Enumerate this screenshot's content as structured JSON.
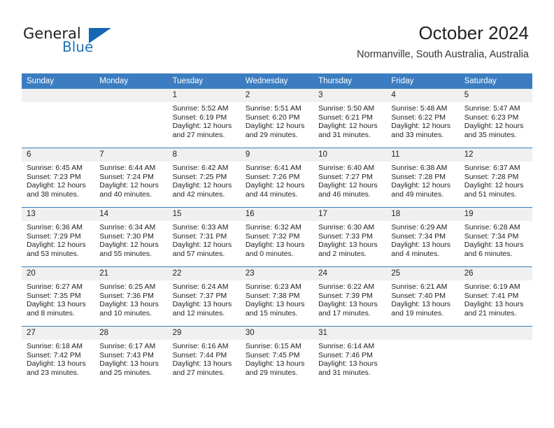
{
  "brand": {
    "word_one": "General",
    "word_two": "Blue",
    "logo_icon": "triangle-logo-icon",
    "accent_color": "#1667b1"
  },
  "header": {
    "title": "October 2024",
    "subtitle": "Normanville, South Australia, Australia"
  },
  "calendar": {
    "header_bg": "#3b7dc0",
    "daynum_bg": "#f0f0f0",
    "weekdays": [
      "Sunday",
      "Monday",
      "Tuesday",
      "Wednesday",
      "Thursday",
      "Friday",
      "Saturday"
    ],
    "weeks": [
      [
        {
          "day": ""
        },
        {
          "day": ""
        },
        {
          "day": "1",
          "sunrise": "Sunrise: 5:52 AM",
          "sunset": "Sunset: 6:19 PM",
          "daylight_1": "Daylight: 12 hours",
          "daylight_2": "and 27 minutes."
        },
        {
          "day": "2",
          "sunrise": "Sunrise: 5:51 AM",
          "sunset": "Sunset: 6:20 PM",
          "daylight_1": "Daylight: 12 hours",
          "daylight_2": "and 29 minutes."
        },
        {
          "day": "3",
          "sunrise": "Sunrise: 5:50 AM",
          "sunset": "Sunset: 6:21 PM",
          "daylight_1": "Daylight: 12 hours",
          "daylight_2": "and 31 minutes."
        },
        {
          "day": "4",
          "sunrise": "Sunrise: 5:48 AM",
          "sunset": "Sunset: 6:22 PM",
          "daylight_1": "Daylight: 12 hours",
          "daylight_2": "and 33 minutes."
        },
        {
          "day": "5",
          "sunrise": "Sunrise: 5:47 AM",
          "sunset": "Sunset: 6:23 PM",
          "daylight_1": "Daylight: 12 hours",
          "daylight_2": "and 35 minutes."
        }
      ],
      [
        {
          "day": "6",
          "sunrise": "Sunrise: 6:45 AM",
          "sunset": "Sunset: 7:23 PM",
          "daylight_1": "Daylight: 12 hours",
          "daylight_2": "and 38 minutes."
        },
        {
          "day": "7",
          "sunrise": "Sunrise: 6:44 AM",
          "sunset": "Sunset: 7:24 PM",
          "daylight_1": "Daylight: 12 hours",
          "daylight_2": "and 40 minutes."
        },
        {
          "day": "8",
          "sunrise": "Sunrise: 6:42 AM",
          "sunset": "Sunset: 7:25 PM",
          "daylight_1": "Daylight: 12 hours",
          "daylight_2": "and 42 minutes."
        },
        {
          "day": "9",
          "sunrise": "Sunrise: 6:41 AM",
          "sunset": "Sunset: 7:26 PM",
          "daylight_1": "Daylight: 12 hours",
          "daylight_2": "and 44 minutes."
        },
        {
          "day": "10",
          "sunrise": "Sunrise: 6:40 AM",
          "sunset": "Sunset: 7:27 PM",
          "daylight_1": "Daylight: 12 hours",
          "daylight_2": "and 46 minutes."
        },
        {
          "day": "11",
          "sunrise": "Sunrise: 6:38 AM",
          "sunset": "Sunset: 7:28 PM",
          "daylight_1": "Daylight: 12 hours",
          "daylight_2": "and 49 minutes."
        },
        {
          "day": "12",
          "sunrise": "Sunrise: 6:37 AM",
          "sunset": "Sunset: 7:28 PM",
          "daylight_1": "Daylight: 12 hours",
          "daylight_2": "and 51 minutes."
        }
      ],
      [
        {
          "day": "13",
          "sunrise": "Sunrise: 6:36 AM",
          "sunset": "Sunset: 7:29 PM",
          "daylight_1": "Daylight: 12 hours",
          "daylight_2": "and 53 minutes."
        },
        {
          "day": "14",
          "sunrise": "Sunrise: 6:34 AM",
          "sunset": "Sunset: 7:30 PM",
          "daylight_1": "Daylight: 12 hours",
          "daylight_2": "and 55 minutes."
        },
        {
          "day": "15",
          "sunrise": "Sunrise: 6:33 AM",
          "sunset": "Sunset: 7:31 PM",
          "daylight_1": "Daylight: 12 hours",
          "daylight_2": "and 57 minutes."
        },
        {
          "day": "16",
          "sunrise": "Sunrise: 6:32 AM",
          "sunset": "Sunset: 7:32 PM",
          "daylight_1": "Daylight: 13 hours",
          "daylight_2": "and 0 minutes."
        },
        {
          "day": "17",
          "sunrise": "Sunrise: 6:30 AM",
          "sunset": "Sunset: 7:33 PM",
          "daylight_1": "Daylight: 13 hours",
          "daylight_2": "and 2 minutes."
        },
        {
          "day": "18",
          "sunrise": "Sunrise: 6:29 AM",
          "sunset": "Sunset: 7:34 PM",
          "daylight_1": "Daylight: 13 hours",
          "daylight_2": "and 4 minutes."
        },
        {
          "day": "19",
          "sunrise": "Sunrise: 6:28 AM",
          "sunset": "Sunset: 7:34 PM",
          "daylight_1": "Daylight: 13 hours",
          "daylight_2": "and 6 minutes."
        }
      ],
      [
        {
          "day": "20",
          "sunrise": "Sunrise: 6:27 AM",
          "sunset": "Sunset: 7:35 PM",
          "daylight_1": "Daylight: 13 hours",
          "daylight_2": "and 8 minutes."
        },
        {
          "day": "21",
          "sunrise": "Sunrise: 6:25 AM",
          "sunset": "Sunset: 7:36 PM",
          "daylight_1": "Daylight: 13 hours",
          "daylight_2": "and 10 minutes."
        },
        {
          "day": "22",
          "sunrise": "Sunrise: 6:24 AM",
          "sunset": "Sunset: 7:37 PM",
          "daylight_1": "Daylight: 13 hours",
          "daylight_2": "and 12 minutes."
        },
        {
          "day": "23",
          "sunrise": "Sunrise: 6:23 AM",
          "sunset": "Sunset: 7:38 PM",
          "daylight_1": "Daylight: 13 hours",
          "daylight_2": "and 15 minutes."
        },
        {
          "day": "24",
          "sunrise": "Sunrise: 6:22 AM",
          "sunset": "Sunset: 7:39 PM",
          "daylight_1": "Daylight: 13 hours",
          "daylight_2": "and 17 minutes."
        },
        {
          "day": "25",
          "sunrise": "Sunrise: 6:21 AM",
          "sunset": "Sunset: 7:40 PM",
          "daylight_1": "Daylight: 13 hours",
          "daylight_2": "and 19 minutes."
        },
        {
          "day": "26",
          "sunrise": "Sunrise: 6:19 AM",
          "sunset": "Sunset: 7:41 PM",
          "daylight_1": "Daylight: 13 hours",
          "daylight_2": "and 21 minutes."
        }
      ],
      [
        {
          "day": "27",
          "sunrise": "Sunrise: 6:18 AM",
          "sunset": "Sunset: 7:42 PM",
          "daylight_1": "Daylight: 13 hours",
          "daylight_2": "and 23 minutes."
        },
        {
          "day": "28",
          "sunrise": "Sunrise: 6:17 AM",
          "sunset": "Sunset: 7:43 PM",
          "daylight_1": "Daylight: 13 hours",
          "daylight_2": "and 25 minutes."
        },
        {
          "day": "29",
          "sunrise": "Sunrise: 6:16 AM",
          "sunset": "Sunset: 7:44 PM",
          "daylight_1": "Daylight: 13 hours",
          "daylight_2": "and 27 minutes."
        },
        {
          "day": "30",
          "sunrise": "Sunrise: 6:15 AM",
          "sunset": "Sunset: 7:45 PM",
          "daylight_1": "Daylight: 13 hours",
          "daylight_2": "and 29 minutes."
        },
        {
          "day": "31",
          "sunrise": "Sunrise: 6:14 AM",
          "sunset": "Sunset: 7:46 PM",
          "daylight_1": "Daylight: 13 hours",
          "daylight_2": "and 31 minutes."
        },
        {
          "day": ""
        },
        {
          "day": ""
        }
      ]
    ]
  }
}
